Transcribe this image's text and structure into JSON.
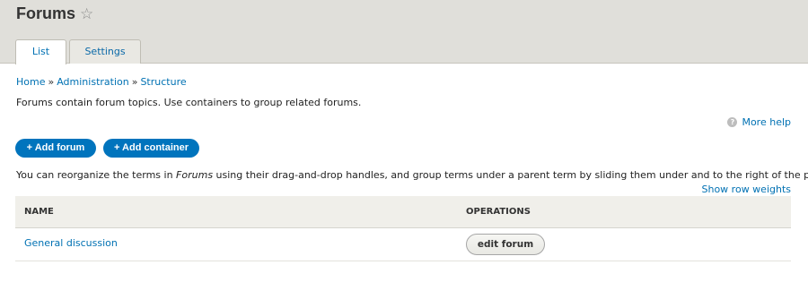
{
  "page": {
    "title": "Forums"
  },
  "tabs": [
    {
      "label": "List"
    },
    {
      "label": "Settings"
    }
  ],
  "breadcrumb": {
    "items": [
      "Home",
      "Administration",
      "Structure"
    ],
    "separator": "»"
  },
  "description": "Forums contain forum topics. Use containers to group related forums.",
  "help": {
    "label": "More help",
    "icon": "?"
  },
  "actions": {
    "add_forum": "+ Add forum",
    "add_container": "+ Add container"
  },
  "instructions": {
    "before": "You can reorganize the terms in ",
    "emphasis": "Forums",
    "after": " using their drag-and-drop handles, and group terms under a parent term by sliding them under and to the right of the parent."
  },
  "weights_link": "Show row weights",
  "table": {
    "headers": {
      "name": "NAME",
      "operations": "OPERATIONS"
    },
    "rows": [
      {
        "name": "General discussion",
        "operation": "edit forum"
      }
    ]
  },
  "colors": {
    "link": "#0071b3",
    "primary_button": "#0074bd",
    "header_bg": "#e0dfda"
  }
}
